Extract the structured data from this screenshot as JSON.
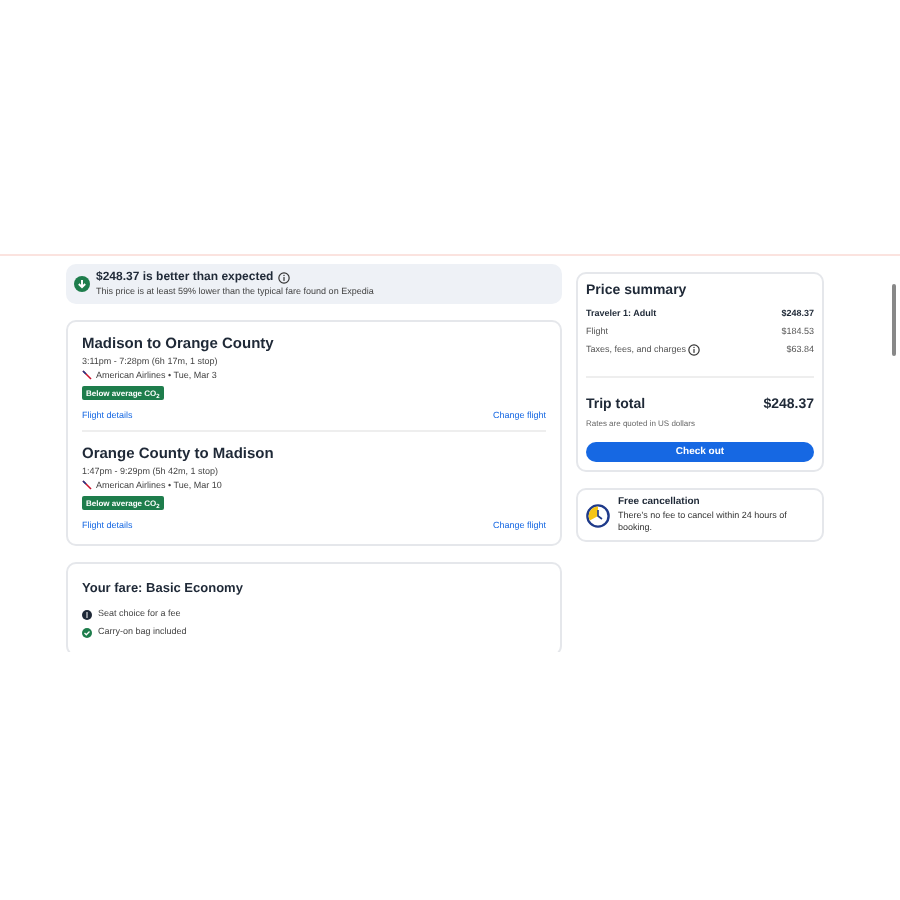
{
  "banner": {
    "title": "$248.37 is better than expected",
    "text": "This price is at least 59% lower than the typical fare found on Expedia"
  },
  "flights": [
    {
      "route": "Madison to Orange County",
      "times": "3:11pm - 7:28pm (6h 17m, 1 stop)",
      "airline": "American Airlines • Tue, Mar 3",
      "badge": "Below average CO$_{2}$",
      "details": "Flight details",
      "change": "Change flight"
    },
    {
      "route": "Orange County to Madison",
      "times": "1:47pm - 9:29pm (5h 42m, 1 stop)",
      "airline": "American Airlines • Tue, Mar 10",
      "badge": "Below average CO$_{2}$",
      "details": "Flight details",
      "change": "Change flight"
    }
  ],
  "fare": {
    "title": "Your fare: Basic Economy",
    "items": [
      {
        "kind": "fee",
        "text": "Seat choice for a fee"
      },
      {
        "kind": "included",
        "text": "Carry-on bag included"
      }
    ]
  },
  "price_summary": {
    "title": "Price summary",
    "traveler": {
      "label": "Traveler 1: Adult",
      "value": "$248.37"
    },
    "lines": [
      {
        "label": "Flight",
        "value": "$184.53",
        "info": false
      },
      {
        "label": "Taxes, fees, and charges",
        "value": "$63.84",
        "info": true
      }
    ],
    "total_label": "Trip total",
    "total_value": "$248.37",
    "note": "Rates are quoted in US dollars",
    "button": "Check out"
  },
  "cancellation": {
    "title": "Free cancellation",
    "text": "There's no fee to cancel within 24 hours of booking."
  }
}
